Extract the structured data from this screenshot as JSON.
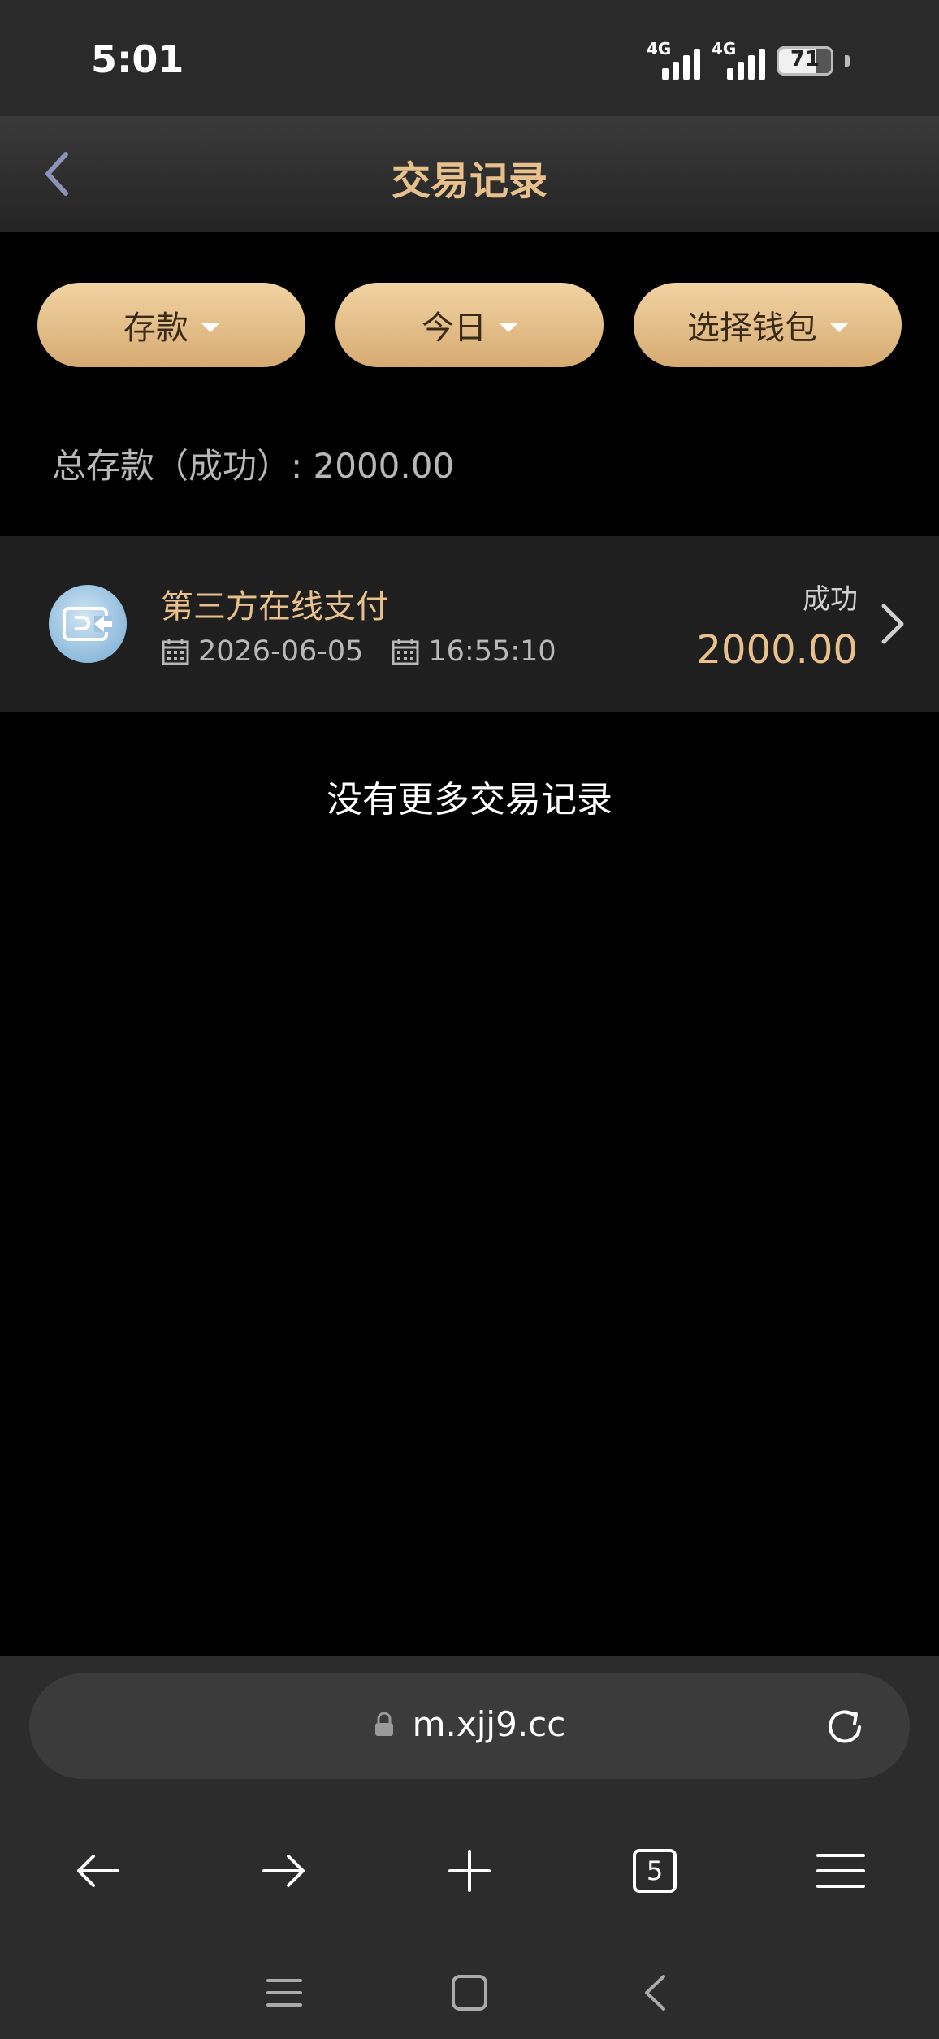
{
  "status_bar": {
    "time": "5:01",
    "network_1": "4G",
    "network_2": "4G",
    "battery": "71"
  },
  "nav": {
    "title": "交易记录"
  },
  "filters": [
    {
      "label": "存款"
    },
    {
      "label": "今日"
    },
    {
      "label": "选择钱包"
    }
  ],
  "summary": {
    "text": "总存款（成功）: 2000.00"
  },
  "records": [
    {
      "name": "第三方在线支付",
      "date": "2026-06-05",
      "time": "16:55:10",
      "status": "成功",
      "amount": "2000.00"
    }
  ],
  "footer_message": "没有更多交易记录",
  "browser": {
    "url": "m.xjj9.cc",
    "tab_count": "5"
  },
  "colors": {
    "accent_gold": "#e7c08b",
    "pill_gold": "#e4c08c",
    "background": "#000000"
  },
  "icons": [
    "back-arrow-icon",
    "caret-down-icon",
    "payment-card-icon",
    "calendar-icon",
    "chevron-right-icon",
    "lock-icon",
    "reload-icon",
    "back-icon",
    "forward-icon",
    "plus-icon",
    "tabs-icon",
    "menu-icon"
  ]
}
